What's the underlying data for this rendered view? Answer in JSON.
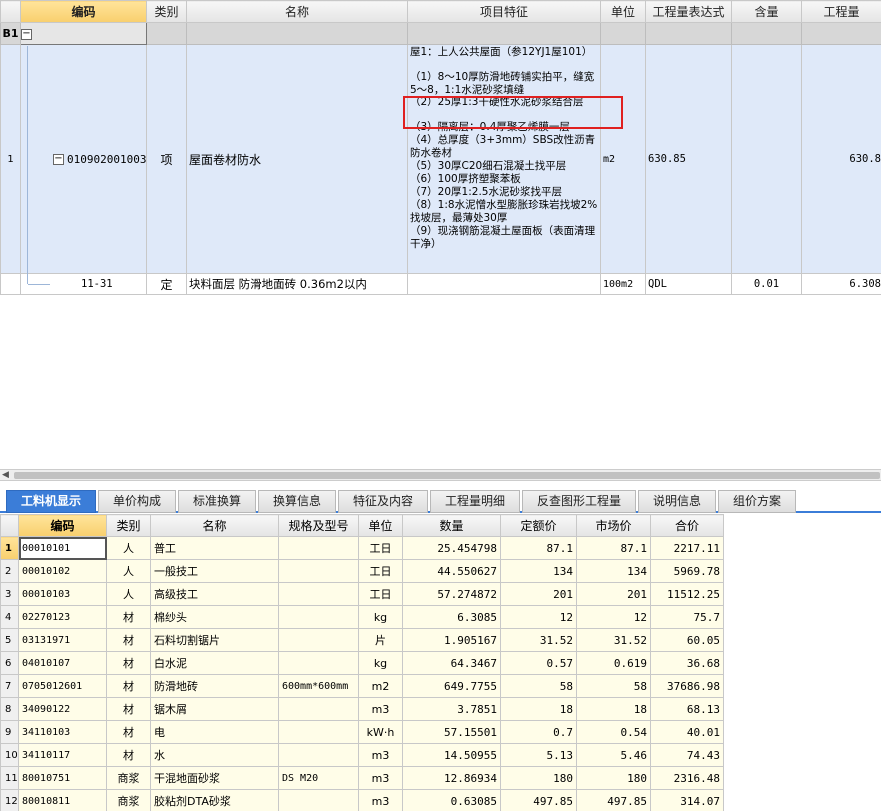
{
  "top_grid": {
    "headers": [
      "编码",
      "类别",
      "名称",
      "项目特征",
      "单位",
      "工程量表达式",
      "含量",
      "工程量"
    ],
    "group_row": {
      "label": "B1",
      "toggle": "−"
    },
    "rows": [
      {
        "index": "1",
        "toggle": "−",
        "code": "010902001003",
        "category": "项",
        "name": "屋面卷材防水",
        "features": [
          "屋1：上人公共屋面（参12YJ1屋101）",
          "（1）8～10厚防滑地砖铺实拍平，缝宽5～8，1:1水泥砂浆填缝",
          "（2）25厚1:3干硬性水泥砂浆结合层",
          "（3）隔离层：0.4厚聚乙烯膜一层",
          "（4）总厚度（3+3mm）SBS改性沥青防水卷材",
          "（5）30厚C20细石混凝土找平层",
          "（6）100厚挤塑聚苯板",
          "（7）20厚1:2.5水泥砂浆找平层",
          "（8）1:8水泥憎水型膨胀珍珠岩找坡2%找坡层，最薄处30厚",
          "（9）现浇钢筋混凝土屋面板（表面清理干净）"
        ],
        "unit": "m2",
        "expression": "630.85",
        "content": "",
        "quantity": "630.8"
      },
      {
        "index": "",
        "code": "11-31",
        "category": "定",
        "name": "块料面层 防滑地面砖 0.36m2以内",
        "features": [],
        "unit": "100m2",
        "expression": "QDL",
        "content": "0.01",
        "quantity": "6.308"
      }
    ]
  },
  "tabs": [
    "工料机显示",
    "单价构成",
    "标准换算",
    "换算信息",
    "特征及内容",
    "工程量明细",
    "反查图形工程量",
    "说明信息",
    "组价方案"
  ],
  "bottom_grid": {
    "headers": [
      "编码",
      "类别",
      "名称",
      "规格及型号",
      "单位",
      "数量",
      "定额价",
      "市场价",
      "合价"
    ],
    "rows": [
      {
        "i": "1",
        "code": "00010101",
        "cat": "人",
        "name": "普工",
        "spec": "",
        "unit": "工日",
        "qty": "25.454798",
        "price": "87.1",
        "market": "87.1",
        "total": "2217.11"
      },
      {
        "i": "2",
        "code": "00010102",
        "cat": "人",
        "name": "一般技工",
        "spec": "",
        "unit": "工日",
        "qty": "44.550627",
        "price": "134",
        "market": "134",
        "total": "5969.78"
      },
      {
        "i": "3",
        "code": "00010103",
        "cat": "人",
        "name": "高级技工",
        "spec": "",
        "unit": "工日",
        "qty": "57.274872",
        "price": "201",
        "market": "201",
        "total": "11512.25"
      },
      {
        "i": "4",
        "code": "02270123",
        "cat": "材",
        "name": "棉纱头",
        "spec": "",
        "unit": "kg",
        "qty": "6.3085",
        "price": "12",
        "market": "12",
        "total": "75.7"
      },
      {
        "i": "5",
        "code": "03131971",
        "cat": "材",
        "name": "石料切割锯片",
        "spec": "",
        "unit": "片",
        "qty": "1.905167",
        "price": "31.52",
        "market": "31.52",
        "total": "60.05"
      },
      {
        "i": "6",
        "code": "04010107",
        "cat": "材",
        "name": "白水泥",
        "spec": "",
        "unit": "kg",
        "qty": "64.3467",
        "price": "0.57",
        "market": "0.619",
        "total": "36.68"
      },
      {
        "i": "7",
        "code": "0705012601",
        "cat": "材",
        "name": "防滑地砖",
        "spec": "600mm*600mm",
        "unit": "m2",
        "qty": "649.7755",
        "price": "58",
        "market": "58",
        "total": "37686.98"
      },
      {
        "i": "8",
        "code": "34090122",
        "cat": "材",
        "name": "锯木屑",
        "spec": "",
        "unit": "m3",
        "qty": "3.7851",
        "price": "18",
        "market": "18",
        "total": "68.13"
      },
      {
        "i": "9",
        "code": "34110103",
        "cat": "材",
        "name": "电",
        "spec": "",
        "unit": "kW·h",
        "qty": "57.15501",
        "price": "0.7",
        "market": "0.54",
        "total": "40.01"
      },
      {
        "i": "10",
        "code": "34110117",
        "cat": "材",
        "name": "水",
        "spec": "",
        "unit": "m3",
        "qty": "14.50955",
        "price": "5.13",
        "market": "5.46",
        "total": "74.43"
      },
      {
        "i": "11",
        "code": "80010751",
        "cat": "商浆",
        "name": "干混地面砂浆",
        "spec": "DS M20",
        "unit": "m3",
        "qty": "12.86934",
        "price": "180",
        "market": "180",
        "total": "2316.48"
      },
      {
        "i": "12",
        "code": "80010811",
        "cat": "商浆",
        "name": "胶粘剂DTA砂浆",
        "spec": "",
        "unit": "m3",
        "qty": "0.63085",
        "price": "497.85",
        "market": "497.85",
        "total": "314.07"
      }
    ]
  },
  "colors": {
    "tab_active": "#3b7dd8",
    "row_selected": "#dfe9f9",
    "highlight_box": "#e02020",
    "material_row": "#fffde8"
  }
}
